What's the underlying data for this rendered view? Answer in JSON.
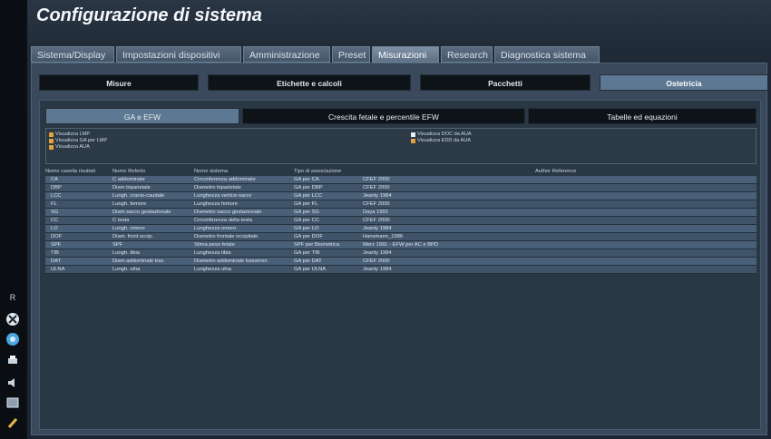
{
  "window": {
    "title": "Configurazione di sistema"
  },
  "tabs": [
    {
      "label": "Sistema/Display",
      "active": false
    },
    {
      "label": "Impostazioni dispositivi",
      "active": false
    },
    {
      "label": "Amministrazione",
      "active": false
    },
    {
      "label": "Preset",
      "active": false
    },
    {
      "label": "Misurazioni",
      "active": true
    },
    {
      "label": "Research",
      "active": false
    },
    {
      "label": "Diagnostica sistema",
      "active": false
    }
  ],
  "subtabs": [
    {
      "label": "Misure",
      "active": false
    },
    {
      "label": "Etichette e calcoli",
      "active": false
    },
    {
      "label": "Pacchetti",
      "active": false
    },
    {
      "label": "Ostetricia",
      "active": true
    }
  ],
  "obstetric_tabs": [
    {
      "label": "GA e EFW",
      "active": true
    },
    {
      "label": "Crescita fetale e percentile EFW",
      "active": false
    },
    {
      "label": "Tabelle ed equazioni",
      "active": false
    }
  ],
  "options": {
    "left": [
      {
        "label": "Visualizza LMP",
        "checked": true
      },
      {
        "label": "Visualizza GA per LMP",
        "checked": true
      },
      {
        "label": "Visualizza AUA",
        "checked": true
      }
    ],
    "right": [
      {
        "label": "Visualizza DOC da AUA",
        "checked": false
      },
      {
        "label": "Visualizza EDD da AUA",
        "checked": true
      }
    ]
  },
  "table": {
    "headers": [
      "Nome casella risultati",
      "Nome Referto",
      "Nome sistema",
      "Tipo di associazione",
      "",
      "Author Reference"
    ],
    "rows": [
      [
        "CA",
        "C addominale",
        "Circonferenza addominale",
        "GA per CA",
        "CFEF 2000",
        ""
      ],
      [
        "DBP",
        "Diam biparietale",
        "Diametro biparietale",
        "GA per DBP",
        "CFEF 2000",
        ""
      ],
      [
        "LCC",
        "Lungh. cranio-caudale",
        "Lunghezza vertice-sacro",
        "GA per LCC",
        "Jeanty 1984",
        ""
      ],
      [
        "FL",
        "Lungh. femore",
        "Lunghezza femore",
        "GA per FL",
        "CFEF 2000",
        ""
      ],
      [
        "SG",
        "Diam sacco gestazionale",
        "Diametro sacco gestazionale",
        "GA per SG",
        "Daya 1991",
        ""
      ],
      [
        "CC",
        "C testa",
        "Circonferenza della testa",
        "GA per CC",
        "CFEF 2000",
        ""
      ],
      [
        "LO",
        "Lungh. omero",
        "Lunghezza omero",
        "GA per LO",
        "Jeanty 1984",
        ""
      ],
      [
        "DOF",
        "Diam. front occip.",
        "Diametro frontale occipitale",
        "GA per DOF",
        "Hansmann_1986",
        ""
      ],
      [
        "SPF",
        "SPF",
        "Stima peso fetale",
        "SPF per Biometrica",
        "Merz 1991 - EFW per AC e BPD",
        ""
      ],
      [
        "TIB",
        "Lungh. tibia",
        "Lunghezza tibia",
        "GA per TIB",
        "Jeanty 1984",
        ""
      ],
      [
        "DAT",
        "Diam addominale tras",
        "Diametro addominale trasverso",
        "GA per DAT",
        "CFEF 2000",
        ""
      ],
      [
        "ULNA",
        "Lungh. ulna",
        "Lunghezza ulna",
        "GA per ULNA",
        "Jeanty 1984",
        ""
      ]
    ]
  },
  "sidebar": {
    "items": [
      {
        "icon": "probe-icon",
        "label": "R"
      },
      {
        "icon": "freeze-icon",
        "label": ""
      },
      {
        "icon": "settings-globe-icon",
        "label": ""
      },
      {
        "icon": "print-icon",
        "label": ""
      },
      {
        "icon": "volume-icon",
        "label": ""
      },
      {
        "icon": "image-icon",
        "label": ""
      },
      {
        "icon": "pen-icon",
        "label": ""
      }
    ]
  },
  "colors": {
    "accent": "#5d7892",
    "checkbox": "#e3a33c",
    "background": "#1c2632"
  }
}
